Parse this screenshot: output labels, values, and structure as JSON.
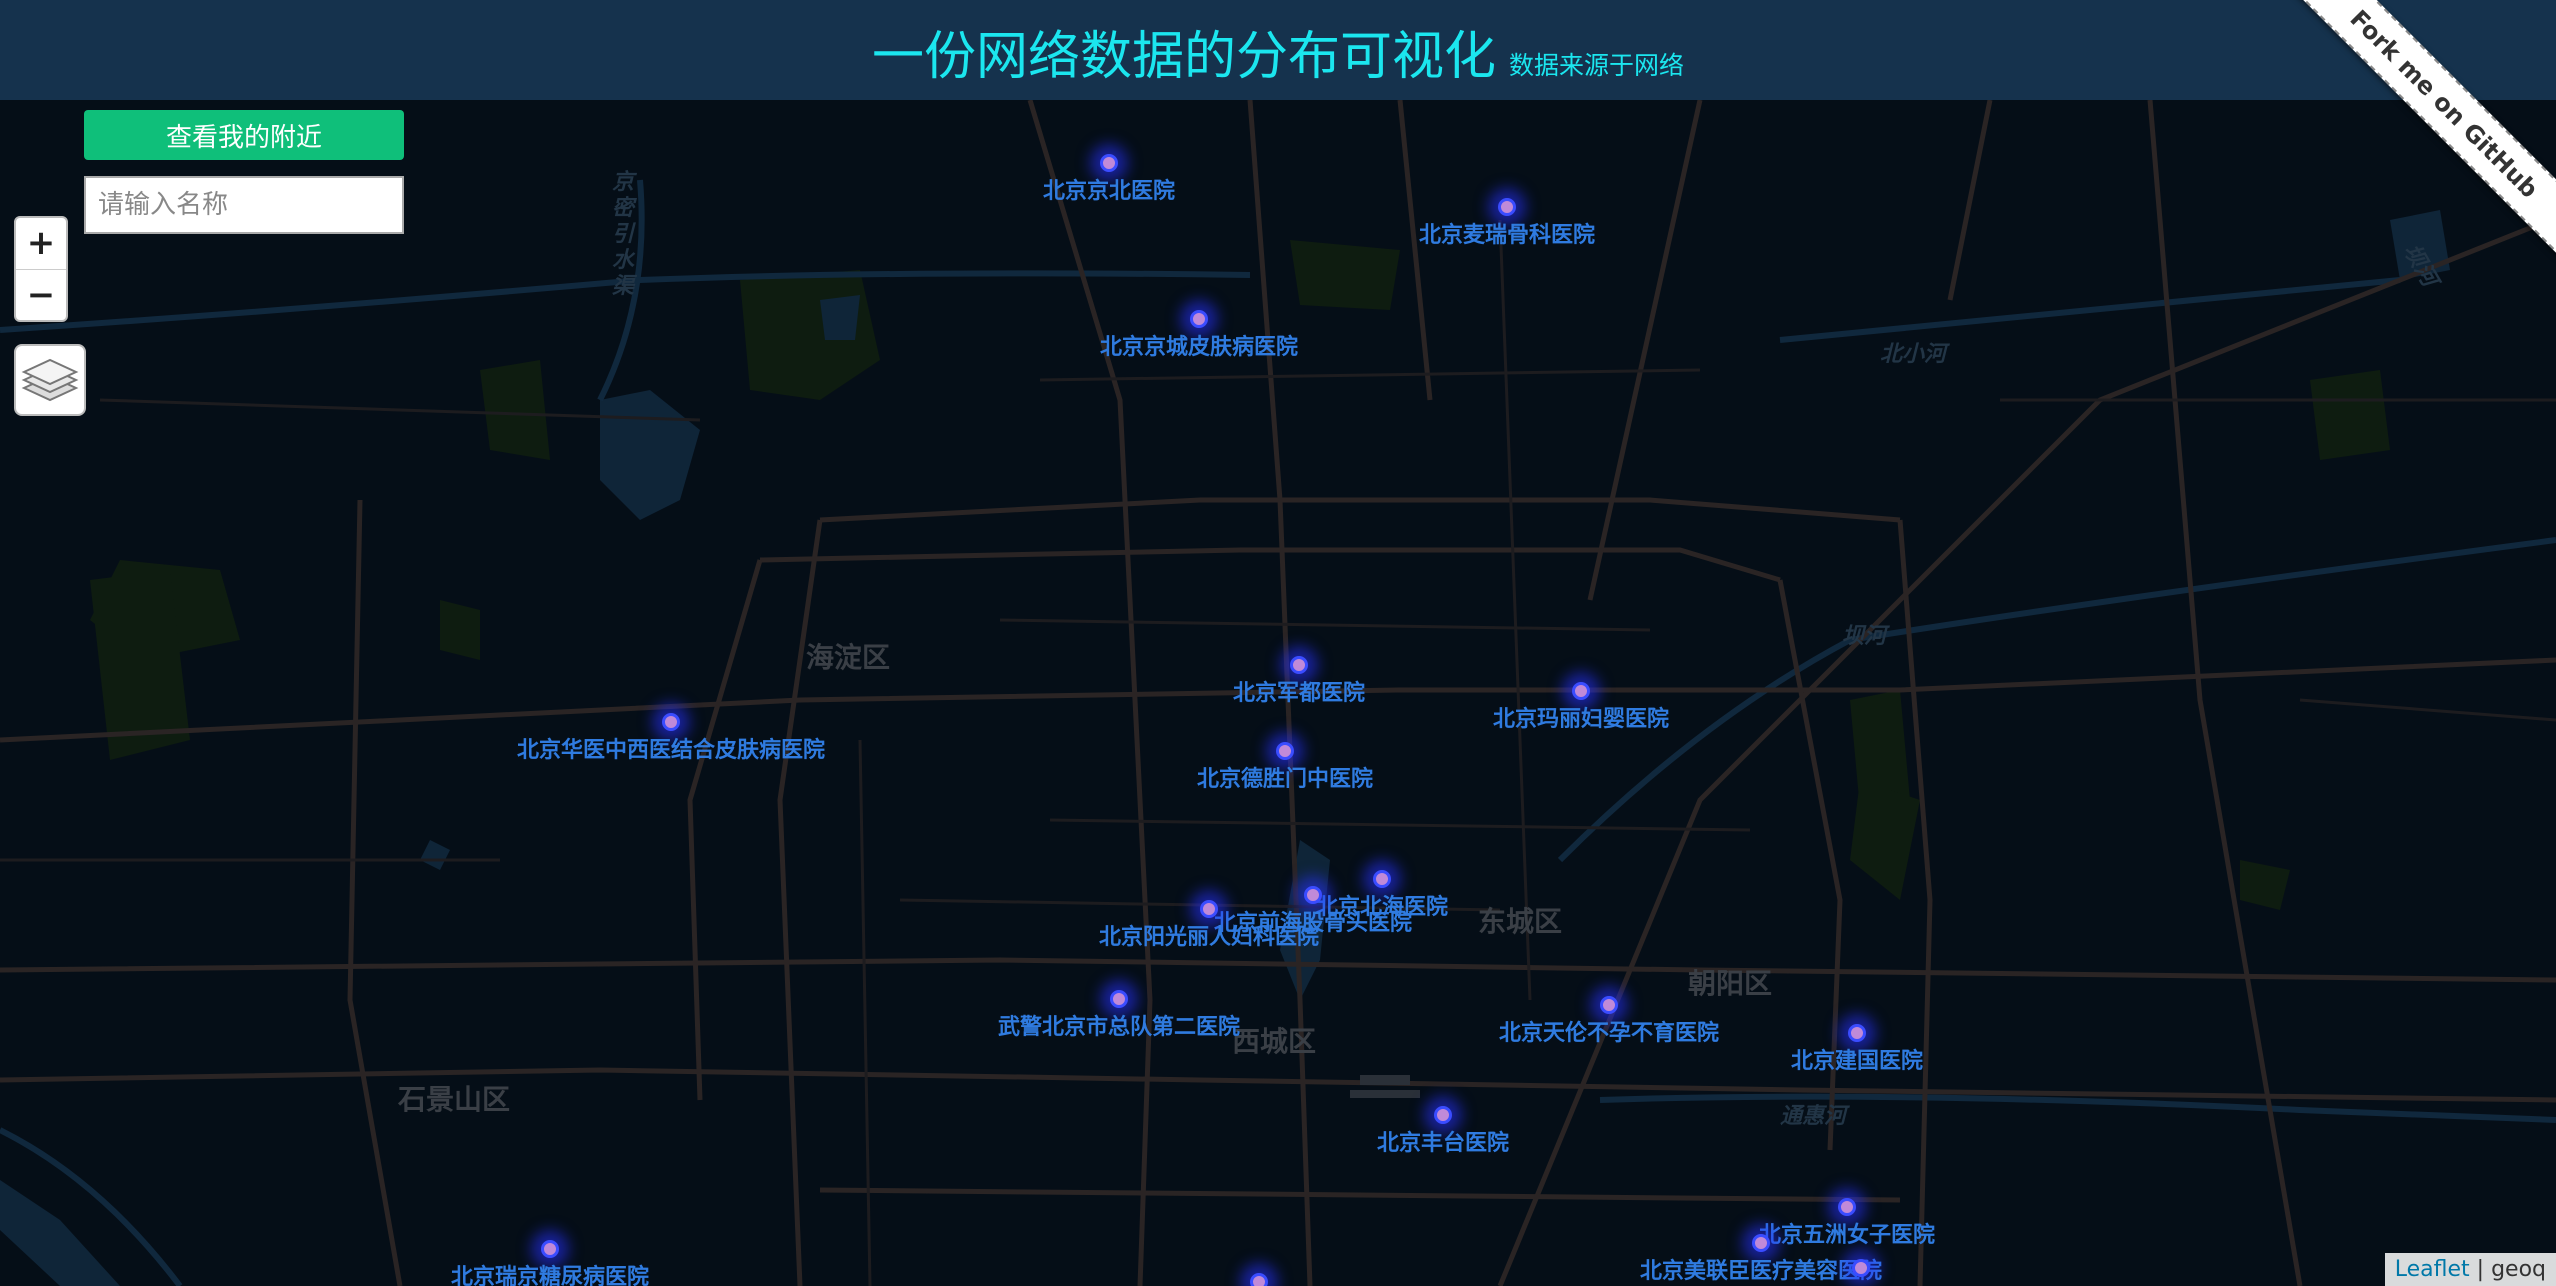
{
  "header": {
    "title": "一份网络数据的分布可视化",
    "subtitle": "数据来源于网络"
  },
  "controls": {
    "zoom_in": "+",
    "zoom_out": "−",
    "nearby_button": "查看我的附近",
    "search_placeholder": "请输入名称"
  },
  "ribbon": {
    "label": "Fork me on GitHub"
  },
  "attribution": {
    "leaflet": "Leaflet",
    "separator": "|",
    "source": "geoq"
  },
  "colors": {
    "header_bg": "#15324d",
    "title": "#1be6ef",
    "button": "#0fbf7a",
    "marker_glow": "#3a4cff",
    "label": "#2f7be0"
  },
  "districts": [
    "海淀区",
    "东城区",
    "朝阳区",
    "西城区",
    "石景山区"
  ],
  "rivers": [
    "京密引水渠",
    "北小河",
    "坝河",
    "通惠河",
    "坝河"
  ],
  "hospitals": [
    "北京京北医院",
    "北京麦瑞骨科医院",
    "北京京城皮肤病医院",
    "北京军都医院",
    "北京玛丽妇婴医院",
    "北京华医中西医结合皮肤病医院",
    "北京德胜门中医院",
    "北京北海医院",
    "北京前海股骨头医院",
    "北京阳光丽人妇科医院",
    "武警北京市总队第二医院",
    "北京天伦不孕不育医院",
    "北京建国医院",
    "北京丰台医院",
    "北京五洲女子医院",
    "北京瑞京糖尿病医院",
    "北京美联臣医疗美容医院"
  ]
}
